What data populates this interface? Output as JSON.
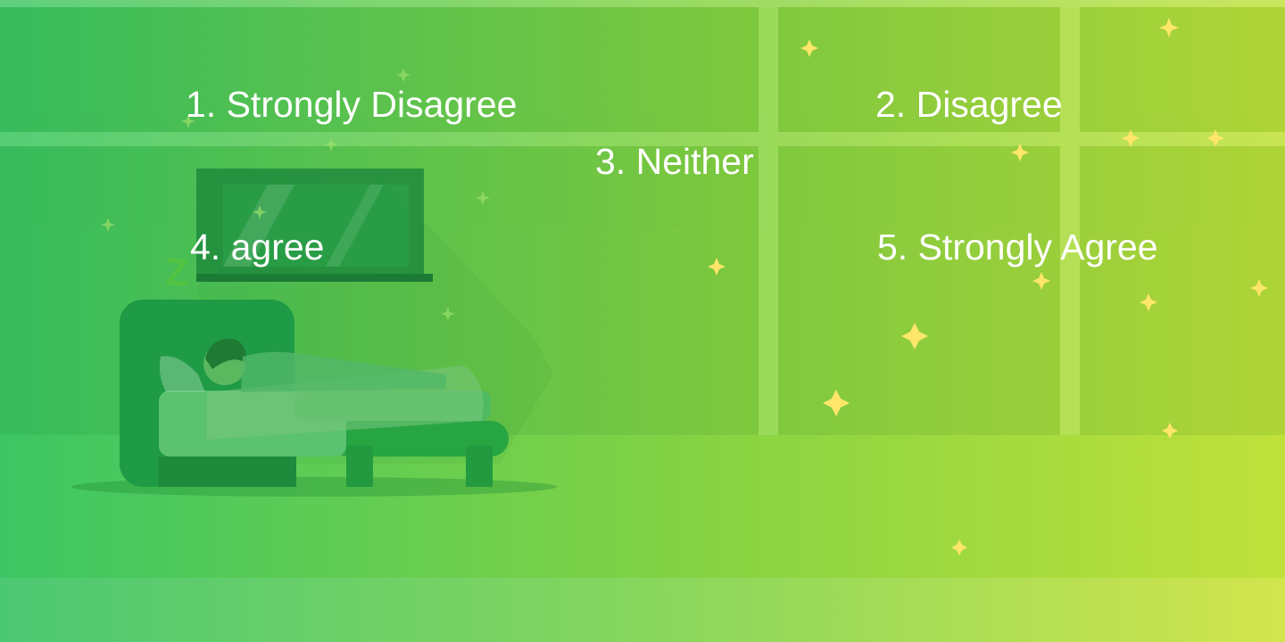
{
  "colors": {
    "bg_left": "#3cc663",
    "bg_right": "#c0e13a",
    "star": "#ffe66b",
    "text": "#ffffff"
  },
  "options": [
    {
      "label": "1. Strongly Disagree"
    },
    {
      "label": "2. Disagree"
    },
    {
      "label": "3. Neither"
    },
    {
      "label": "4. agree"
    },
    {
      "label": "5. Strongly Agree"
    }
  ]
}
